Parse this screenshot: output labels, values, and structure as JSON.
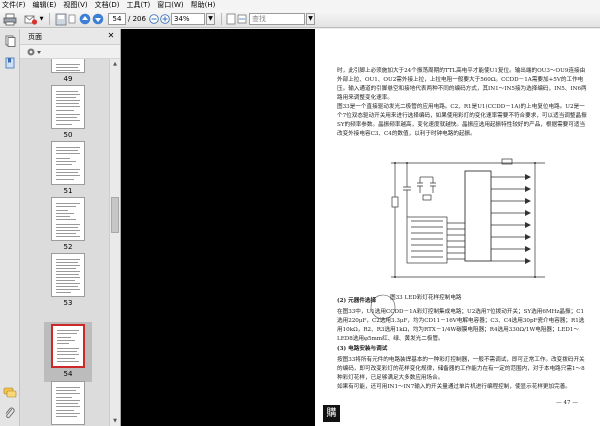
{
  "menu": [
    "文件(F)",
    "编辑(E)",
    "视图(V)",
    "文档(D)",
    "工具(T)",
    "窗口(W)",
    "帮助(H)"
  ],
  "toolbar": {
    "current_page": "54",
    "page_total": "/ 206",
    "zoom": "34%",
    "find_placeholder": "查找"
  },
  "panel": {
    "title": "页面",
    "thumbnails": [
      {
        "label": "49"
      },
      {
        "label": "50"
      },
      {
        "label": "51"
      },
      {
        "label": "52"
      },
      {
        "label": "53"
      },
      {
        "label": "54",
        "selected": true
      },
      {
        "label": "55"
      }
    ]
  },
  "doc": {
    "para1": "时，此引脚上必须施加大于24个振荡周期的TTL高电平才能使U1复位。输出端的OU3～OU9连接由外部上拉、OU1、OU2需外接上拉，上拉电阻一般要大于560Ω。CCDD－1A需要加+5V的工作电压。输入通道的引脚悬空和接地代表两种不同的编码方式，其IN1～IN5接为选择编码，IN5、IN6两路用来调整变化速率。",
    "para2": "图33是一个直接驱动发光二极管的应用电路。C2、R1是U1(CCDD－1A)的上电复位电路。U2是一个7位双态驱动开关用来进行选择编码，如果使用彩灯的变化速率需要不符合要求，可以适当调整晶振SY的频率参数。晶振频率越高，变化速度就越快。晶振应选用起振特性较好的产品，根据需要可适当改变外接电容C3、C4的数值，以利于时钟电路的起振。",
    "figure_caption": "图33  LED彩灯花样控制电路",
    "heading2": "(2) 元器件选择",
    "para3": "在图33中，U1选用CCDD－1A彩灯控制集成电路；U2选用7位拨动开关；SY选用6MHz晶振；C1选用220μF，C2选用3.3μF，均为CD11－16V电解电容器；C3、C4选用30pF瓷介电容器；R1选用10kΩ，R2、R3选用1kΩ，均为RTX－1/4W碳膜电阻器；R4选用330Ω/1W电阻器；LED1～LED8选用φ5mm红、绿、黄发光二极管。",
    "heading3": "(3) 电路安装与调试",
    "para4": "按图33将所有元件的电路装焊基本的一种彩灯控制器，一般不需调试，即可正常工作。改变拨码开关的编码，即可改变彩灯的花样变化规律，储备器的工作能力在有一定的范围内，对于本电路只需1～8种彩灯花样，已足够满足大多数应用场合。",
    "para5": "如果有可能，还可用IN1～IN7输入的开关量通过单片机进行编程控制，使显示花样更加完善。",
    "page_number": "— 47 —",
    "stamp_text": "購"
  },
  "colors": {
    "selection": "#cc2a2a",
    "gutter": "#000000"
  },
  "icons": [
    "print-icon",
    "email-icon",
    "save-icon",
    "nav-up-icon",
    "nav-down-icon",
    "zoom-out-icon",
    "zoom-in-icon",
    "pages-icon",
    "bookmarks-icon",
    "comments-icon",
    "attachments-icon"
  ]
}
